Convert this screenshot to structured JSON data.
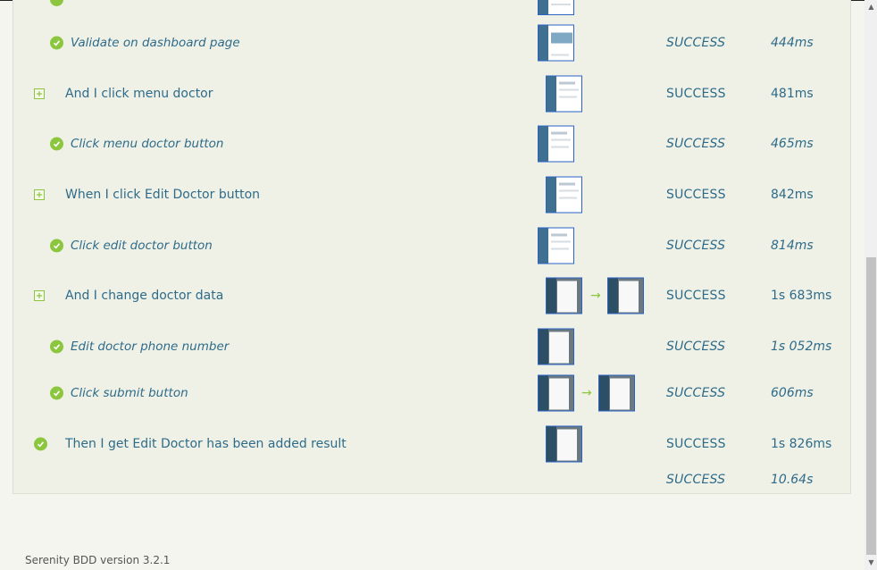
{
  "steps": [
    {
      "label": "Validate on dashboard page",
      "status": "SUCCESS",
      "duration": "444ms"
    },
    {
      "label": "And I click menu doctor",
      "status": "SUCCESS",
      "duration": "481ms"
    },
    {
      "label": "Click menu doctor button",
      "status": "SUCCESS",
      "duration": "465ms"
    },
    {
      "label": "When I click Edit Doctor button",
      "status": "SUCCESS",
      "duration": "842ms"
    },
    {
      "label": "Click edit doctor button",
      "status": "SUCCESS",
      "duration": "814ms"
    },
    {
      "label": "And I change doctor data",
      "status": "SUCCESS",
      "duration": "1s 683ms"
    },
    {
      "label": "Edit doctor phone number",
      "status": "SUCCESS",
      "duration": "1s 052ms"
    },
    {
      "label": "Click submit button",
      "status": "SUCCESS",
      "duration": "606ms"
    },
    {
      "label": "Then I get Edit Doctor has been added result",
      "status": "SUCCESS",
      "duration": "1s 826ms"
    }
  ],
  "total": {
    "status": "SUCCESS",
    "duration": "10.64s"
  },
  "footer": {
    "version": "Serenity BDD version 3.2.1"
  },
  "colors": {
    "success": "#8cc63f",
    "text": "#2e6b8a"
  },
  "icons": {
    "collapsed": "expand-plus-icon",
    "done": "check-circle-icon",
    "transition": "arrow-right-icon"
  }
}
